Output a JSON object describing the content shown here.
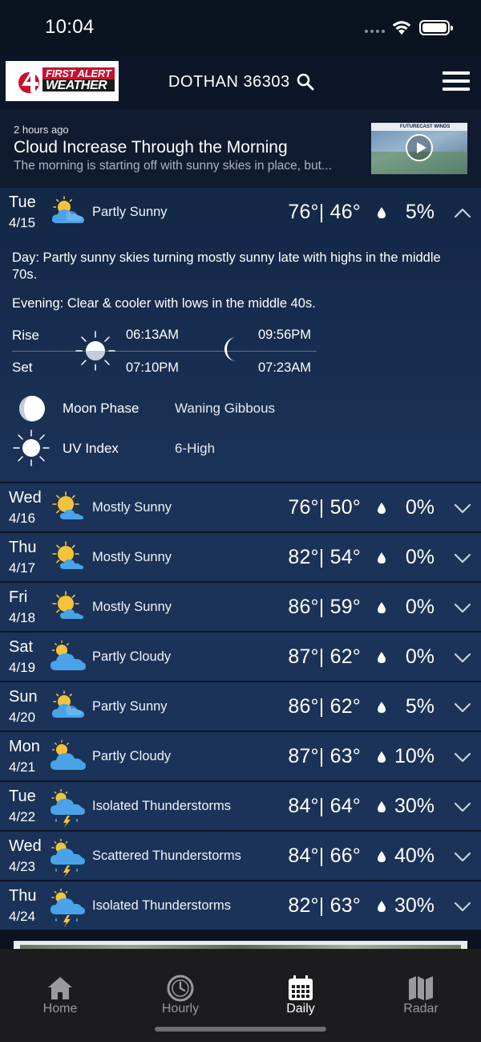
{
  "status_bar": {
    "time": "10:04"
  },
  "header": {
    "logo_line1": "FIRST ALERT",
    "logo_line2": "WEATHER",
    "location": "DOTHAN 36303"
  },
  "article": {
    "time_ago": "2 hours ago",
    "title": "Cloud Increase Through the Morning",
    "summary": "The morning is starting off with sunny skies in place, but...",
    "thumbnail_caption": "FUTURECAST WINDS"
  },
  "expanded_day": {
    "day": "Tue",
    "date": "4/15",
    "icon": "partly-sunny-icon",
    "condition": "Partly Sunny",
    "temps": "76°| 46°",
    "precip": "5%",
    "day_label": "Day:",
    "day_text": "Partly sunny skies turning mostly sunny late with highs in the middle 70s.",
    "evening_label": "Evening:",
    "evening_text": "Clear & cooler with lows in the middle 40s.",
    "rise_label": "Rise",
    "set_label": "Set",
    "sunrise": "06:13AM",
    "sunset": "07:10PM",
    "moonrise": "09:56PM",
    "moonset": "07:23AM",
    "moon_phase_label": "Moon Phase",
    "moon_phase_value": "Waning Gibbous",
    "uv_label": "UV Index",
    "uv_value": "6-High"
  },
  "days": [
    {
      "day": "Wed",
      "date": "4/16",
      "icon": "mostly-sunny-icon",
      "condition": "Mostly Sunny",
      "temps": "76°| 50°",
      "precip": "0%"
    },
    {
      "day": "Thu",
      "date": "4/17",
      "icon": "mostly-sunny-icon",
      "condition": "Mostly Sunny",
      "temps": "82°| 54°",
      "precip": "0%"
    },
    {
      "day": "Fri",
      "date": "4/18",
      "icon": "mostly-sunny-icon",
      "condition": "Mostly Sunny",
      "temps": "86°| 59°",
      "precip": "0%"
    },
    {
      "day": "Sat",
      "date": "4/19",
      "icon": "partly-cloudy-icon",
      "condition": "Partly Cloudy",
      "temps": "87°| 62°",
      "precip": "0%"
    },
    {
      "day": "Sun",
      "date": "4/20",
      "icon": "partly-sunny-icon",
      "condition": "Partly Sunny",
      "temps": "86°| 62°",
      "precip": "5%"
    },
    {
      "day": "Mon",
      "date": "4/21",
      "icon": "partly-cloudy-icon",
      "condition": "Partly Cloudy",
      "temps": "87°| 63°",
      "precip": "10%"
    },
    {
      "day": "Tue",
      "date": "4/22",
      "icon": "thunderstorm-icon",
      "condition": "Isolated Thunderstorms",
      "temps": "84°| 64°",
      "precip": "30%"
    },
    {
      "day": "Wed",
      "date": "4/23",
      "icon": "thunderstorm-icon",
      "condition": "Scattered Thunderstorms",
      "temps": "84°| 66°",
      "precip": "40%"
    },
    {
      "day": "Thu",
      "date": "4/24",
      "icon": "thunderstorm-icon",
      "condition": "Isolated Thunderstorms",
      "temps": "82°| 63°",
      "precip": "30%"
    }
  ],
  "tabs": [
    {
      "label": "Home",
      "icon": "home-icon",
      "active": false
    },
    {
      "label": "Hourly",
      "icon": "clock-icon",
      "active": false
    },
    {
      "label": "Daily",
      "icon": "calendar-icon",
      "active": true
    },
    {
      "label": "Radar",
      "icon": "map-icon",
      "active": false
    }
  ],
  "colors": {
    "background": "#0b1220",
    "row": "#1b3358",
    "logo_red": "#c8102e",
    "sun": "#f5c33b",
    "cloud": "#4aa3e8",
    "tab_bar": "#1c1c1e"
  }
}
